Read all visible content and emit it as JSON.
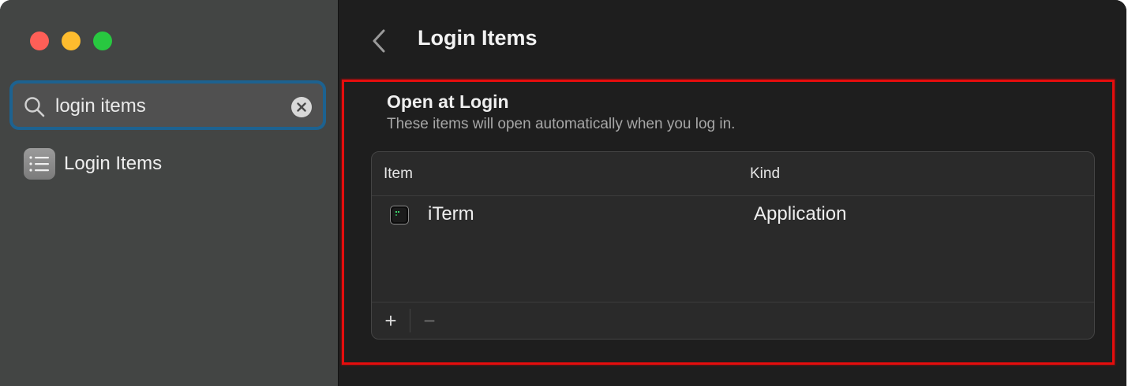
{
  "sidebar": {
    "search": {
      "value": "login items"
    },
    "results": [
      {
        "label": "Login Items"
      }
    ]
  },
  "main": {
    "title": "Login Items",
    "section": {
      "title": "Open at Login",
      "subtitle": "These items will open automatically when you log in.",
      "table": {
        "headers": {
          "item": "Item",
          "kind": "Kind"
        },
        "rows": [
          {
            "name": "iTerm",
            "kind": "Application"
          }
        ],
        "add_label": "+",
        "remove_label": "−"
      }
    }
  },
  "colors": {
    "highlight_border": "#e60d0d",
    "search_focus": "#1d6290",
    "close": "#fe5f57",
    "minimize": "#febc2e",
    "zoom": "#28c840"
  },
  "icons": {
    "search": "magnifying-glass",
    "clear": "x-circle",
    "back": "chevron-left",
    "sidebar_item": "list-app-icon",
    "row": "iterm-app-icon"
  }
}
